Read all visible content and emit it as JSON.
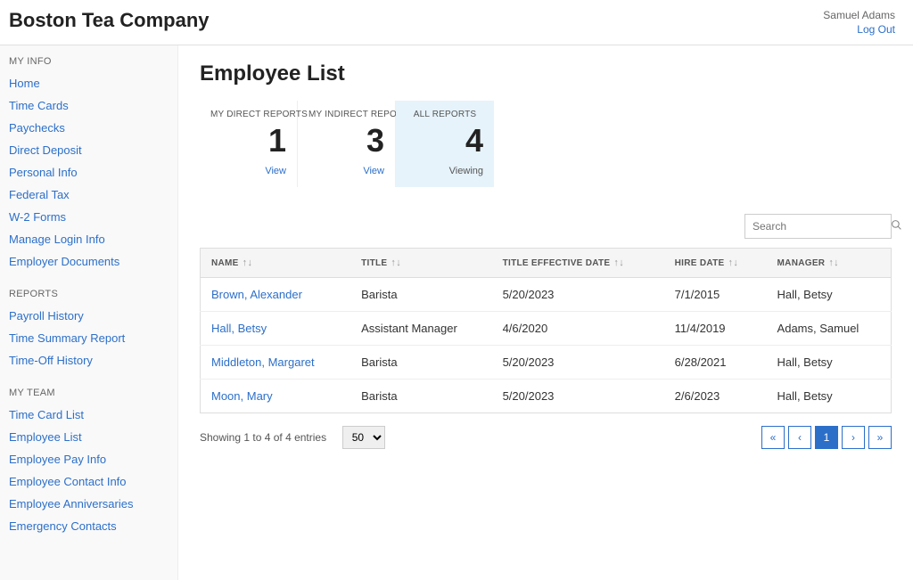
{
  "header": {
    "company": "Boston Tea Company",
    "user": "Samuel Adams",
    "logout": "Log Out"
  },
  "sidebar": {
    "sections": [
      {
        "heading": "MY INFO",
        "items": [
          "Home",
          "Time Cards",
          "Paychecks",
          "Direct Deposit",
          "Personal Info",
          "Federal Tax",
          "W-2 Forms",
          "Manage Login Info",
          "Employer Documents"
        ]
      },
      {
        "heading": "REPORTS",
        "items": [
          "Payroll History",
          "Time Summary Report",
          "Time-Off History"
        ]
      },
      {
        "heading": "MY TEAM",
        "items": [
          "Time Card List",
          "Employee List",
          "Employee Pay Info",
          "Employee Contact Info",
          "Employee Anniversaries",
          "Emergency Contacts"
        ]
      }
    ]
  },
  "page": {
    "title": "Employee List"
  },
  "report_cards": [
    {
      "label": "MY DIRECT REPORTS",
      "number": "1",
      "link": "View",
      "active": false
    },
    {
      "label": "MY INDIRECT REPORTS",
      "number": "3",
      "link": "View",
      "active": false
    },
    {
      "label": "ALL REPORTS",
      "number": "4",
      "link": "Viewing",
      "active": true
    }
  ],
  "search": {
    "placeholder": "Search"
  },
  "table": {
    "columns": [
      "NAME",
      "TITLE",
      "TITLE EFFECTIVE DATE",
      "HIRE DATE",
      "MANAGER"
    ],
    "rows": [
      {
        "name": "Brown, Alexander",
        "title": "Barista",
        "title_effective": "5/20/2023",
        "hire_date": "7/1/2015",
        "manager": "Hall, Betsy"
      },
      {
        "name": "Hall, Betsy",
        "title": "Assistant Manager",
        "title_effective": "4/6/2020",
        "hire_date": "11/4/2019",
        "manager": "Adams, Samuel"
      },
      {
        "name": "Middleton, Margaret",
        "title": "Barista",
        "title_effective": "5/20/2023",
        "hire_date": "6/28/2021",
        "manager": "Hall, Betsy"
      },
      {
        "name": "Moon, Mary",
        "title": "Barista",
        "title_effective": "5/20/2023",
        "hire_date": "2/6/2023",
        "manager": "Hall, Betsy"
      }
    ]
  },
  "footer": {
    "showing": "Showing 1 to 4 of 4 entries",
    "page_size": "50",
    "current_page": "1"
  }
}
